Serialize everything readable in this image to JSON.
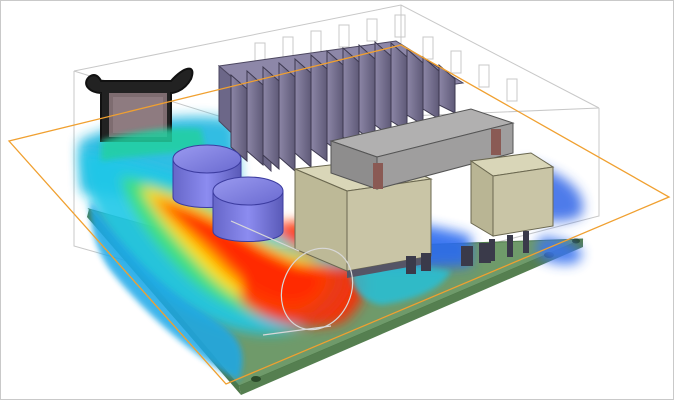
{
  "viewer": {
    "render_type": "thermal CFD simulation of a power electronics enclosure",
    "colors": {
      "background": "#ffffff",
      "border": "#c9c9c9",
      "cut_plane": "#f0a030",
      "enclosure": "#c8c8c8",
      "pcb": "#6f9a6a",
      "heatsink": "#7b7594",
      "inductor": "#c9c5a6",
      "capacitor": "#7474d8",
      "flow_hot": "#ff2a00",
      "flow_warm": "#ffe000",
      "flow_mid": "#25e0c0",
      "flow_cool": "#1a6df0"
    }
  }
}
